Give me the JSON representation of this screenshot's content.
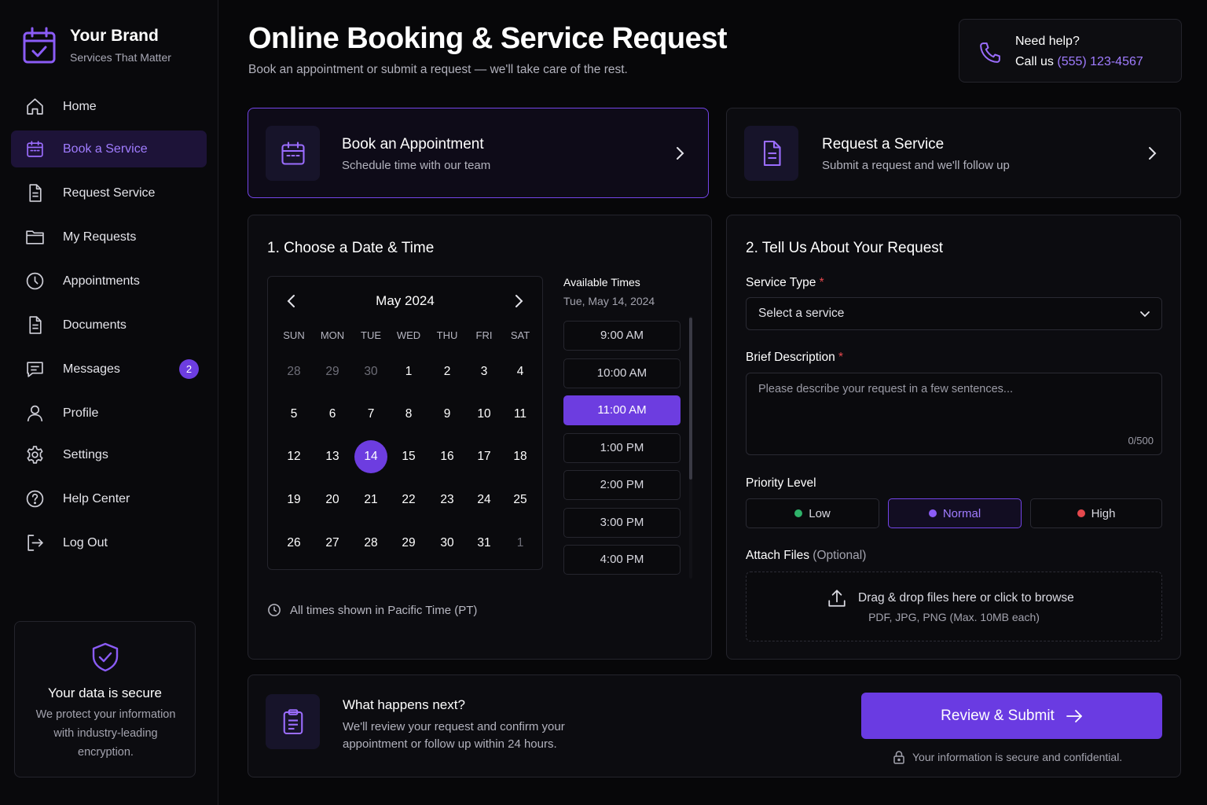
{
  "brand": {
    "name": "Your Brand",
    "tagline": "Services That Matter"
  },
  "sidebar": {
    "items": [
      {
        "label": "Home",
        "icon": "home-icon"
      },
      {
        "label": "Book a Service",
        "icon": "calendar-icon",
        "active": true
      },
      {
        "label": "Request Service",
        "icon": "document-icon"
      },
      {
        "label": "My Requests",
        "icon": "folder-icon"
      },
      {
        "label": "Appointments",
        "icon": "clock-icon"
      },
      {
        "label": "Documents",
        "icon": "document-icon"
      },
      {
        "label": "Messages",
        "icon": "message-icon",
        "badge": "2"
      },
      {
        "label": "Profile",
        "icon": "user-icon"
      },
      {
        "label": "Settings",
        "icon": "gear-icon"
      },
      {
        "label": "Help Center",
        "icon": "help-icon"
      },
      {
        "label": "Log Out",
        "icon": "logout-icon"
      }
    ],
    "secure": {
      "title": "Your data is secure",
      "description": "We protect your information with industry-leading encryption."
    }
  },
  "header": {
    "title": "Online Booking & Service Request",
    "subtitle": "Book an appointment or submit a request — we'll take care of the rest."
  },
  "help": {
    "title": "Need help?",
    "call_prefix": "Call us",
    "phone": "(555) 123-4567"
  },
  "options": [
    {
      "title": "Book an Appointment",
      "subtitle": "Schedule time with our team",
      "selected": true
    },
    {
      "title": "Request a Service",
      "subtitle": "Submit a request and we'll follow up",
      "selected": false
    }
  ],
  "datetime": {
    "title": "1. Choose a Date & Time",
    "month_label": "May 2024",
    "weekdays": [
      "SUN",
      "MON",
      "TUE",
      "WED",
      "THU",
      "FRI",
      "SAT"
    ],
    "weeks": [
      [
        "28",
        "29",
        "30",
        "1",
        "2",
        "3",
        "4"
      ],
      [
        "5",
        "6",
        "7",
        "8",
        "9",
        "10",
        "11"
      ],
      [
        "12",
        "13",
        "14",
        "15",
        "16",
        "17",
        "18"
      ],
      [
        "19",
        "20",
        "21",
        "22",
        "23",
        "24",
        "25"
      ],
      [
        "26",
        "27",
        "28",
        "29",
        "30",
        "31",
        "1"
      ]
    ],
    "selected_day": "14",
    "times_heading": "Available Times",
    "times_date": "Tue, May 14, 2024",
    "times": [
      "9:00 AM",
      "10:00 AM",
      "11:00 AM",
      "1:00 PM",
      "2:00 PM",
      "3:00 PM",
      "4:00 PM"
    ],
    "selected_time": "11:00 AM",
    "timezone_note": "All times shown in Pacific Time (PT)"
  },
  "request_form": {
    "title": "2. Tell Us About Your Request",
    "service_type_label": "Service Type",
    "service_type_value": "Select a service",
    "required_mark": "*",
    "description_label": "Brief Description",
    "description_placeholder": "Please describe your request in a few sentences...",
    "char_count": "0/500",
    "priority_label": "Priority Level",
    "priorities": [
      {
        "label": "Low",
        "color": "#2fb36a"
      },
      {
        "label": "Normal",
        "color": "#8b5cf6",
        "selected": true
      },
      {
        "label": "High",
        "color": "#e5484d"
      }
    ],
    "attach_label": "Attach Files",
    "attach_optional": "(Optional)",
    "drop_text": "Drag & drop files here or click to browse",
    "drop_formats": "PDF, JPG, PNG (Max. 10MB each)"
  },
  "next_steps": {
    "title": "What happens next?",
    "description": "We'll review your request and confirm your appointment or follow up within 24 hours.",
    "submit_label": "Review & Submit",
    "confidential_note": "Your information is secure and confidential."
  },
  "colors": {
    "accent": "#6d3de0",
    "accent_text": "#a07cff",
    "background": "#070709"
  }
}
